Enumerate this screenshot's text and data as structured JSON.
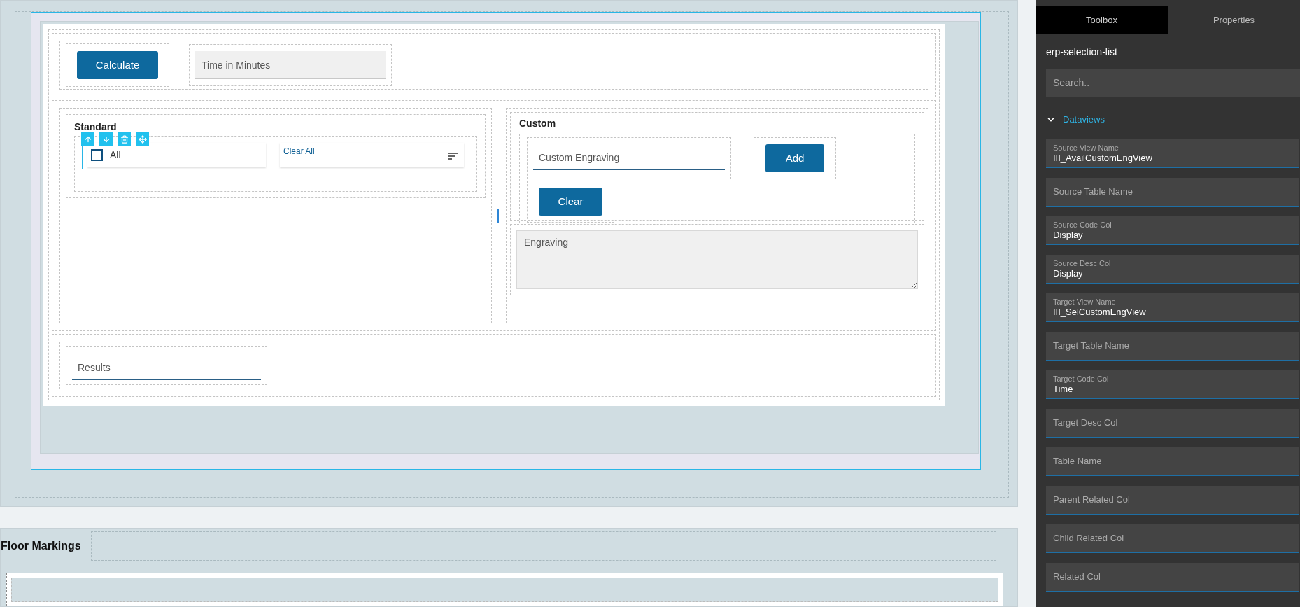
{
  "form": {
    "calculate_button": "Calculate",
    "time_field": {
      "placeholder": "Time in Minutes"
    },
    "standard": {
      "title": "Standard",
      "list": {
        "items": [
          {
            "label": "All",
            "checked": false
          }
        ],
        "clear_link": "Clear All"
      }
    },
    "custom": {
      "title": "Custom",
      "engraving_field": {
        "placeholder": "Custom Engraving"
      },
      "add_button": "Add",
      "clear_button": "Clear",
      "engraving_area": {
        "placeholder": "Engraving"
      }
    },
    "results_field": {
      "placeholder": "Results"
    }
  },
  "floor_section": {
    "title": "Floor Markings"
  },
  "panel": {
    "tabs": [
      {
        "label": "Toolbox",
        "selected": true
      },
      {
        "label": "Properties",
        "selected": false
      }
    ],
    "component": "erp-selection-list",
    "search": {
      "placeholder": "Search.."
    },
    "group": {
      "label": "Dataviews",
      "expanded": true
    },
    "properties": [
      {
        "label": "Source View Name",
        "value": "III_AvailCustomEngView"
      },
      {
        "label": "Source Table Name"
      },
      {
        "label": "Source Code Col",
        "value": "Display"
      },
      {
        "label": "Source Desc Col",
        "value": "Display"
      },
      {
        "label": "Target View Name",
        "value": "III_SelCustomEngView"
      },
      {
        "label": "Target Table Name"
      },
      {
        "label": "Target Code Col",
        "value": "Time"
      },
      {
        "label": "Target Desc Col"
      },
      {
        "label": "Table Name"
      },
      {
        "label": "Parent Related Col"
      },
      {
        "label": "Child Related Col"
      },
      {
        "label": "Related Col"
      }
    ]
  }
}
